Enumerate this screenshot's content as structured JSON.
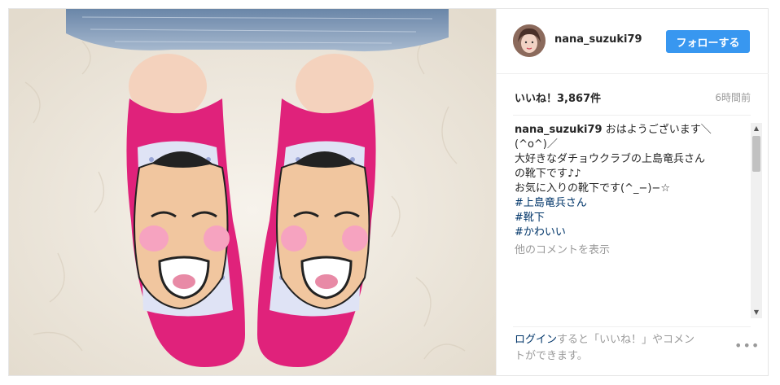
{
  "post": {
    "username": "nana_suzuki79",
    "follow_label": "フォローする",
    "likes": "いいね！3,867件",
    "time": "6時間前",
    "caption": {
      "user": "nana_suzuki79",
      "lines": [
        "おはようございます＼",
        "(^o^)／",
        "大好きなダチョウクラブの上島竜兵さん",
        "の靴下です♪♪",
        "お気に入りの靴下です(^_−)−☆"
      ],
      "hashtags": [
        "#上島竜兵さん",
        "#靴下",
        "#かわいい"
      ]
    },
    "more_comments": "他のコメントを表示",
    "footer": {
      "login": "ログイン",
      "rest": "すると「いいね！」やコメントができます。"
    },
    "more_options": "•••"
  }
}
